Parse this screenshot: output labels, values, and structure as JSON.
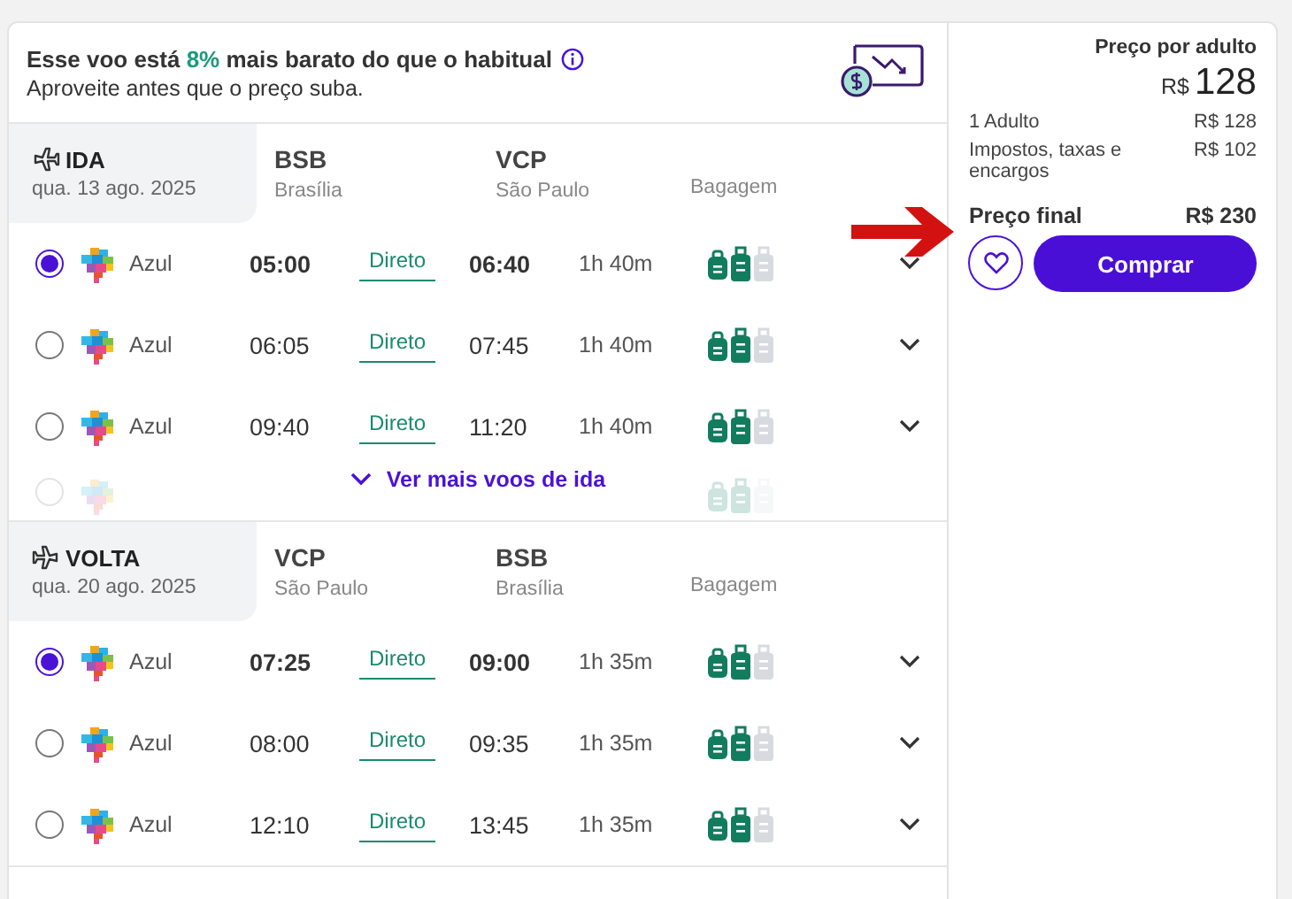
{
  "banner": {
    "text_before": "Esse voo está ",
    "highlight": "8%",
    "text_after": " mais barato do que o habitual",
    "subline": "Aproveite antes que o preço suba."
  },
  "segments": [
    {
      "kind": "outbound",
      "label": "IDA",
      "date": "qua. 13 ago. 2025",
      "origin": {
        "code": "BSB",
        "city": "Brasília"
      },
      "destination": {
        "code": "VCP",
        "city": "São Paulo"
      },
      "baggage_label": "Bagagem",
      "more_link": "Ver mais voos de ida",
      "faded_flight": {
        "selected": false
      },
      "flights": [
        {
          "selected": true,
          "airline": "Azul",
          "depart": "05:00",
          "stops": "Direto",
          "arrive": "06:40",
          "duration": "1h 40m",
          "bags": [
            {
              "included": true
            },
            {
              "included": true
            },
            {
              "included": false
            }
          ]
        },
        {
          "selected": false,
          "airline": "Azul",
          "depart": "06:05",
          "stops": "Direto",
          "arrive": "07:45",
          "duration": "1h 40m",
          "bags": [
            {
              "included": true
            },
            {
              "included": true
            },
            {
              "included": false
            }
          ]
        },
        {
          "selected": false,
          "airline": "Azul",
          "depart": "09:40",
          "stops": "Direto",
          "arrive": "11:20",
          "duration": "1h 40m",
          "bags": [
            {
              "included": true
            },
            {
              "included": true
            },
            {
              "included": false
            }
          ]
        }
      ]
    },
    {
      "kind": "return",
      "label": "VOLTA",
      "date": "qua. 20 ago. 2025",
      "origin": {
        "code": "VCP",
        "city": "São Paulo"
      },
      "destination": {
        "code": "BSB",
        "city": "Brasília"
      },
      "baggage_label": "Bagagem",
      "flights": [
        {
          "selected": true,
          "airline": "Azul",
          "depart": "07:25",
          "stops": "Direto",
          "arrive": "09:00",
          "duration": "1h 35m",
          "bags": [
            {
              "included": true
            },
            {
              "included": true
            },
            {
              "included": false
            }
          ]
        },
        {
          "selected": false,
          "airline": "Azul",
          "depart": "08:00",
          "stops": "Direto",
          "arrive": "09:35",
          "duration": "1h 35m",
          "bags": [
            {
              "included": true
            },
            {
              "included": true
            },
            {
              "included": false
            }
          ]
        },
        {
          "selected": false,
          "airline": "Azul",
          "depart": "12:10",
          "stops": "Direto",
          "arrive": "13:45",
          "duration": "1h 35m",
          "bags": [
            {
              "included": true
            },
            {
              "included": true
            },
            {
              "included": false
            }
          ]
        }
      ]
    }
  ],
  "price": {
    "title": "Preço por adulto",
    "currency": "R$",
    "amount": "128",
    "lines": [
      {
        "label": "1 Adulto",
        "value": "R$ 128"
      },
      {
        "label": "Impostos, taxas e encargos",
        "value": "R$ 102"
      }
    ],
    "total_label": "Preço final",
    "total_value": "R$ 230",
    "buy_button": "Comprar"
  }
}
